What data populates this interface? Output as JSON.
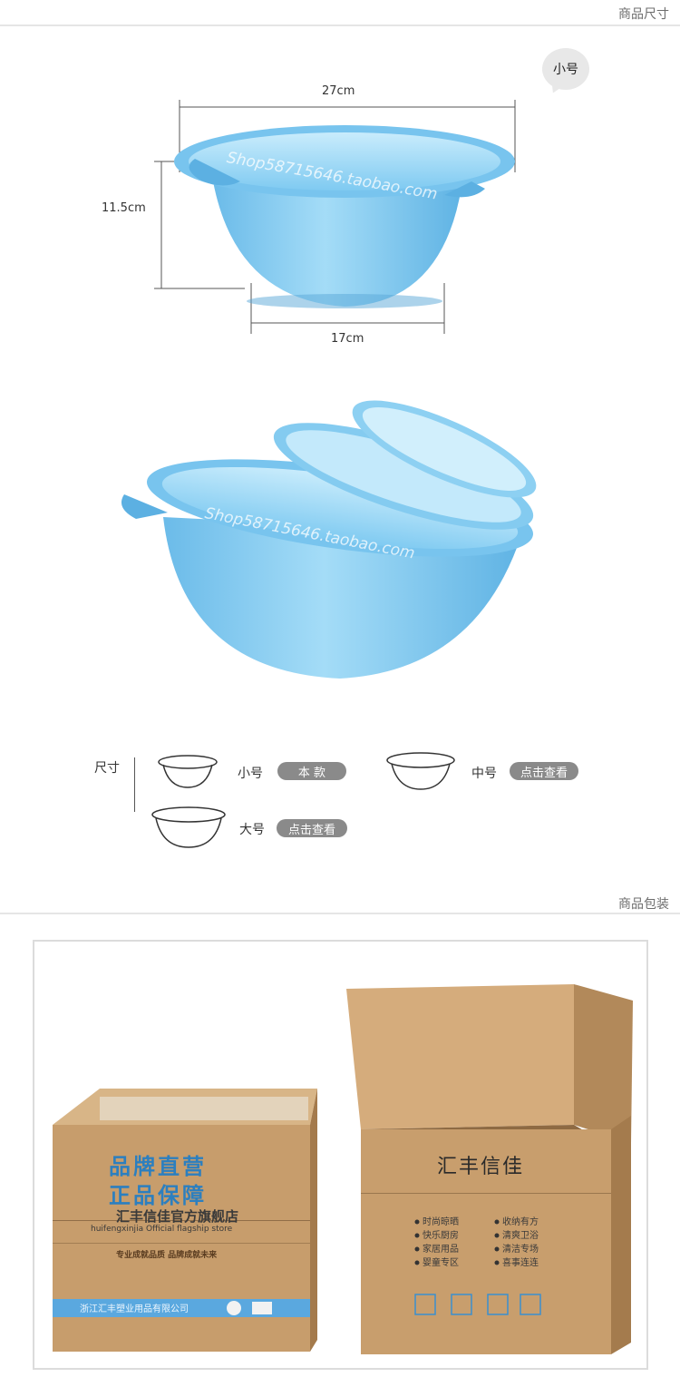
{
  "size_section": {
    "title": "商品尺寸",
    "badge": "小号",
    "dimensions": {
      "width_top": "27cm",
      "height": "11.5cm",
      "width_bottom": "17cm"
    },
    "watermark": "Shop58715646.taobao.com"
  },
  "size_selector": {
    "label": "尺寸",
    "options": [
      {
        "name": "小号",
        "tag": "本 款"
      },
      {
        "name": "中号",
        "tag": "点击查看"
      },
      {
        "name": "大号",
        "tag": "点击查看"
      }
    ]
  },
  "packaging_section": {
    "title": "商品包装",
    "closed_box": {
      "headline1": "品牌直营",
      "headline2": "正品保障",
      "store_name": "汇丰信佳官方旗舰店",
      "store_en": "huifengxinjia Official flagship store",
      "slogan": "专业成就品质  品牌成就未来",
      "company": "浙江汇丰塑业用品有限公司"
    },
    "open_box": {
      "brand": "汇丰信佳",
      "features_left": [
        "时尚晾晒",
        "快乐厨房",
        "家居用品",
        "婴童专区"
      ],
      "features_right": [
        "收纳有方",
        "清爽卫浴",
        "清洁专场",
        "喜事连连"
      ]
    }
  },
  "colors": {
    "basin_blue": "#7cc6ef",
    "cardboard": "#c9a274",
    "pill_gray": "#8a8a8a"
  }
}
